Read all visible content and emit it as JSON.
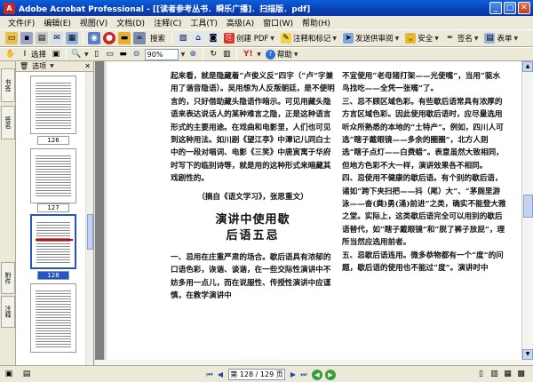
{
  "window": {
    "title": "Adobe Acrobat Professional - [[读者参考丛书．瞬乐广播]．扫描版．pdf]",
    "app_icon": "acrobat-icon",
    "buttons": [
      "minimize",
      "maximize",
      "close"
    ]
  },
  "menubar": {
    "items": [
      "文件(F)",
      "编辑(E)",
      "视图(V)",
      "文档(D)",
      "注释(C)",
      "工具(T)",
      "高级(A)",
      "窗口(W)",
      "帮助(H)"
    ]
  },
  "toolbar1": {
    "create_pdf": "创建 PDF",
    "comment": "注释和标记",
    "send_review": "发送供审阅",
    "secure": "安全",
    "sign": "签名",
    "forms": "表单",
    "organizer": "组织",
    "search": "搜索"
  },
  "toolbar2": {
    "select_tool": "选择",
    "zoom_value": "90%",
    "help": "帮助"
  },
  "nav_tabs": {
    "bookmarks": "书签",
    "signatures": "签名",
    "attachments": "附件",
    "comments": "注释"
  },
  "thumbnails": {
    "options_label": "选项",
    "pages": [
      {
        "label": "126",
        "selected": false
      },
      {
        "label": "127",
        "selected": false
      },
      {
        "label": "128",
        "selected": true
      },
      {
        "label": "129",
        "selected": false
      }
    ]
  },
  "document": {
    "left_column": {
      "para1": "起来看，就是隐藏着“卢俊义反”四字（“卢”字兼用了谐音隐语）。吴用想为人反叛朝廷，是不便明言的，只好借助藏头隐语作暗示。可见用藏头隐语来表达说话人的某种难言之隐，正是这种语言形式的主要用途。在戏曲和电影里，人们也可见到这种用法。如川剧《望江亭》中潭记儿同白士中的一段对唱词、电影《三笑》中唐寅寓于华府时写下的临别诗等，就是用的这种形式来暗藏其戏剧性的。",
      "source": "（摘自《语文学习》，张思重文）",
      "heading1": "演讲中使用歇",
      "heading2": "后语五忌",
      "para2_lead": "一、忌用在庄重严肃的场合。",
      "para2": "歇后语具有浓郁的口语色彩，诙谐、谈谐，在一些交际性演讲中不妨多用一点儿，而在说服性、传授性演讲中应谨慎，在教学演讲中"
    },
    "right_column": {
      "para1": "不宜使用“老母猪打架——光使嘴”，当用“驱水鸟找吃——全凭一张嘴”了。",
      "para2_lead": "三、忌不顾区域色彩。",
      "para2": "有些歇后语常具有浓厚的方言区域色彩。因此使用歇后语时，应尽量选用听众所熟悉的本地的“土特产”。例如，四川人可选“瞎子戴眼镜——多余的圈圈”，北方人则选“瞎子点灯——白费蜡”。表意虽然大致相同，但地方色彩不大一样，演讲效果各不相同。",
      "para3_lead": "四、忌使用不健康的歇后语。",
      "para3": "有个别的歇后语，诸如“跨下夹扫把——抖（尾）大”、“茅厕里游泳——奋(粪)勇(涌)前进”之类，确实不能登大雅之堂。实际上，这类歇后语完全可以用别的歇后语替代，如“瞎子戴眼镜”和“脱了裤子放屁”，理所当然应选用前者。",
      "para4_lead": "五、忌歇后语连用。",
      "para4": "微多恭物都有一个“度”的问题，歇后语的使用也不能过“度”。演讲时中"
    }
  },
  "statusbar": {
    "page_indicator": "第 128 / 129 页"
  },
  "colors": {
    "titlebar": "#0a3fb5",
    "accent": "#2455c8",
    "chrome": "#ece9d8"
  }
}
